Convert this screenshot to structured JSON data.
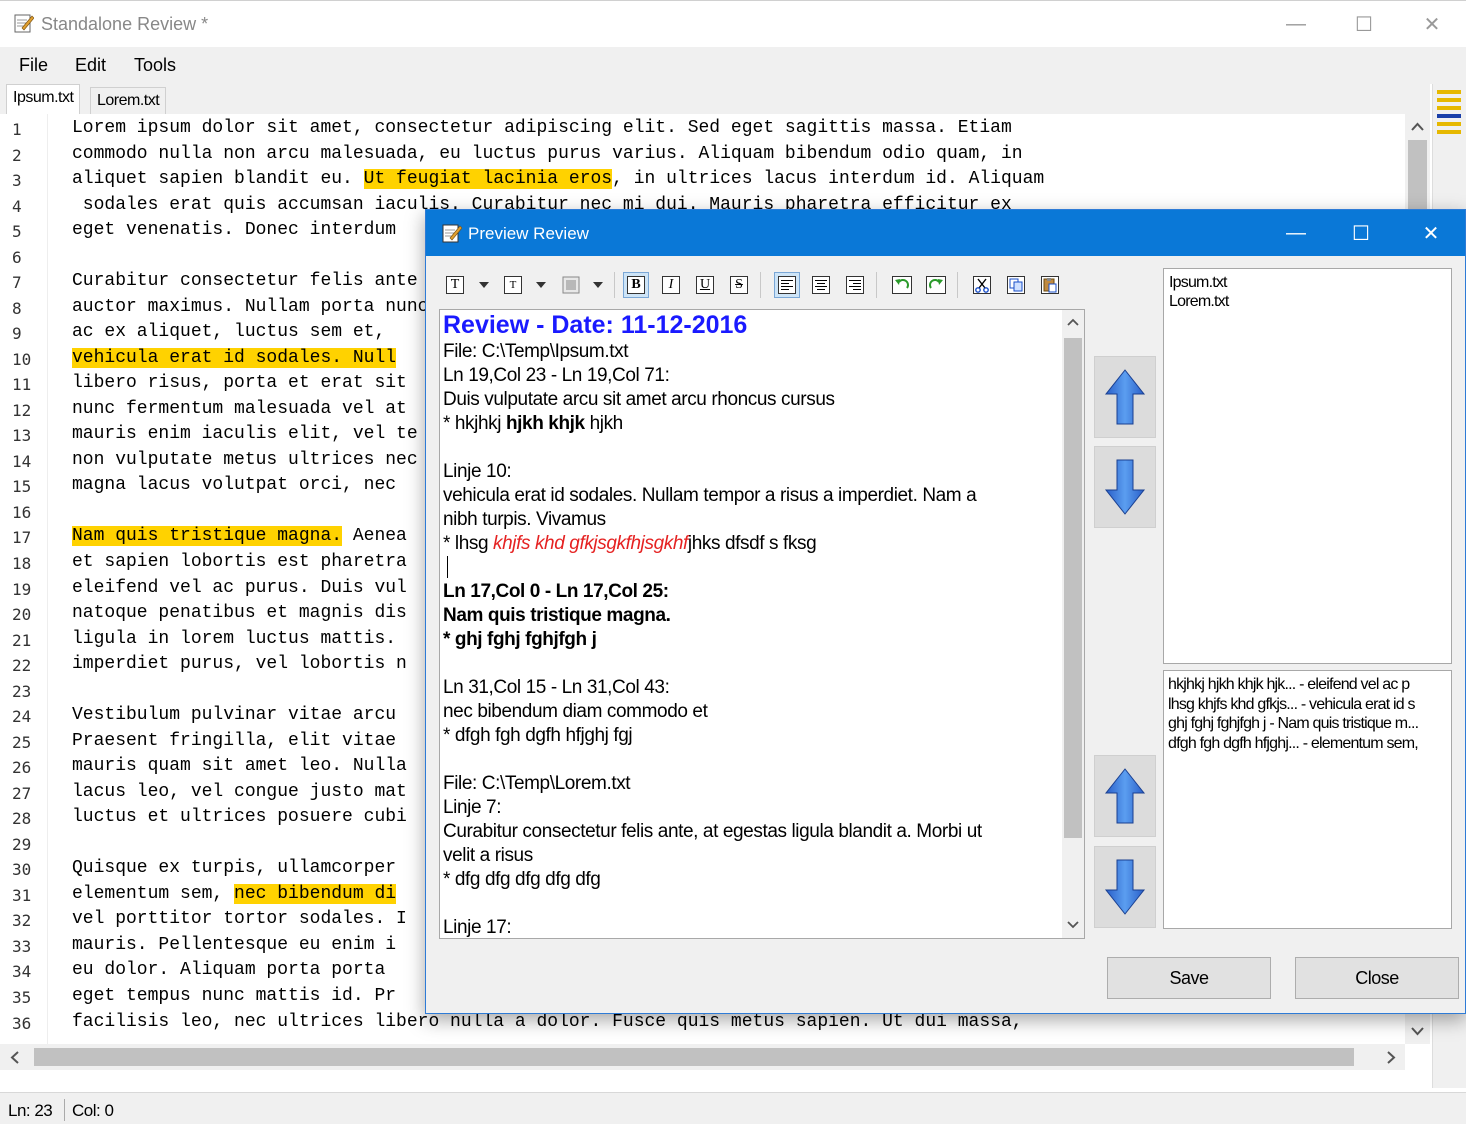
{
  "main": {
    "title": "Standalone Review *",
    "controls": {
      "minimize": "—",
      "maximize": "☐",
      "close": "✕"
    },
    "menu": [
      "File",
      "Edit",
      "Tools"
    ],
    "tabs": [
      "Ipsum.txt",
      "Lorem.txt"
    ],
    "line_numbers": [
      "1",
      "2",
      "3",
      "4",
      "5",
      "6",
      "7",
      "8",
      "9",
      "10",
      "11",
      "12",
      "13",
      "14",
      "15",
      "16",
      "17",
      "18",
      "19",
      "20",
      "21",
      "22",
      "23",
      "24",
      "25",
      "26",
      "27",
      "28",
      "29",
      "30",
      "31",
      "32",
      "33",
      "34",
      "35",
      "36"
    ],
    "code_lines": [
      {
        "pre": "Lorem ipsum dolor sit amet, consectetur adipiscing elit. Sed eget sagittis massa. Etiam"
      },
      {
        "pre": "commodo nulla non arcu malesuada, eu luctus purus varius. Aliquam bibendum odio quam, in"
      },
      {
        "pre": "aliquet sapien blandit eu. ",
        "hl": "Ut feugiat lacinia eros",
        "post": ", in ultrices lacus interdum id. Aliquam"
      },
      {
        "pre": " sodales erat quis accumsan iaculis. Curabitur nec mi dui. Mauris pharetra efficitur ex"
      },
      {
        "pre": "eget venenatis. Donec interdum"
      },
      {
        "pre": ""
      },
      {
        "pre": "Curabitur consectetur felis ante"
      },
      {
        "pre": "auctor maximus. Nullam porta nunc"
      },
      {
        "pre": "ac ex aliquet, luctus sem et, "
      },
      {
        "hl": "vehicula erat id sodales. Null"
      },
      {
        "pre": "libero risus, porta et erat sit"
      },
      {
        "pre": "nunc fermentum malesuada vel at"
      },
      {
        "pre": "mauris enim iaculis elit, vel te"
      },
      {
        "pre": "non vulputate metus ultrices nec"
      },
      {
        "pre": "magna lacus volutpat orci, nec"
      },
      {
        "pre": ""
      },
      {
        "hl": "Nam quis tristique magna.",
        "post": " Aenea"
      },
      {
        "pre": "et sapien lobortis est pharetra"
      },
      {
        "pre": "eleifend vel ac purus. Duis vul"
      },
      {
        "pre": "natoque penatibus et magnis dis"
      },
      {
        "pre": "ligula in lorem luctus mattis. "
      },
      {
        "pre": "imperdiet purus, vel lobortis n"
      },
      {
        "pre": ""
      },
      {
        "pre": "Vestibulum pulvinar vitae arcu "
      },
      {
        "pre": "Praesent fringilla, elit vitae "
      },
      {
        "pre": "mauris quam sit amet leo. Nulla"
      },
      {
        "pre": "lacus leo, vel congue justo mat"
      },
      {
        "pre": "luctus et ultrices posuere cubi"
      },
      {
        "pre": ""
      },
      {
        "pre": "Quisque ex turpis, ullamcorper "
      },
      {
        "pre": "elementum sem, ",
        "hl": "nec bibendum di"
      },
      {
        "pre": "vel porttitor tortor sodales. I"
      },
      {
        "pre": "mauris. Pellentesque eu enim i"
      },
      {
        "pre": "eu dolor. Aliquam porta porta "
      },
      {
        "pre": "eget tempus nunc mattis id. Pr"
      },
      {
        "pre": "facilisis leo, nec ultrices libero nulla a dolor. Fusce quis metus sapien. Ut dui massa,"
      }
    ],
    "status": {
      "line": "Ln: 23",
      "col": "Col: 0"
    }
  },
  "dialog": {
    "title": "Preview Review",
    "controls": {
      "minimize": "—",
      "maximize": "☐",
      "close": "✕"
    },
    "toolbar": {
      "font_glyph": "T",
      "size_glyph": "T",
      "bold": "B",
      "italic": "I",
      "underline": "U",
      "strike": "S"
    },
    "review": {
      "title": "Review - Date: 11-12-2016",
      "lines": [
        {
          "text": "File: C:\\Temp\\Ipsum.txt"
        },
        {
          "text": "Ln 19,Col 23 - Ln 19,Col 71:"
        },
        {
          "text": "Duis vulputate arcu sit amet arcu rhoncus cursus"
        },
        {
          "text": "* hkjhkj ",
          "bold": "hjkh khjk",
          "after": " hjkh"
        },
        {
          "text": ""
        },
        {
          "text": "Linje 10:"
        },
        {
          "text": "vehicula erat id sodales. Nullam tempor a risus a imperdiet. Nam a"
        },
        {
          "text": "nibh turpis. Vivamus"
        },
        {
          "text": "* lhsg ",
          "red": "khjfs khd gfkjsgkfhjsgkhf",
          "after": "jhks dfsdf s fksg"
        },
        {
          "text": ""
        },
        {
          "bold": "Ln 17,Col 0 - Ln 17,Col 25:"
        },
        {
          "bold": "Nam quis tristique magna."
        },
        {
          "bold": "*  ghj fghj fghjfgh j"
        },
        {
          "text": ""
        },
        {
          "text": "Ln 31,Col 15 - Ln 31,Col 43:"
        },
        {
          "text": "nec bibendum diam commodo et"
        },
        {
          "text": "* dfgh fgh dgfh hfjghj fgj"
        },
        {
          "text": ""
        },
        {
          "text": "File: C:\\Temp\\Lorem.txt"
        },
        {
          "text": "Linje 7:"
        },
        {
          "text": "Curabitur consectetur felis ante, at egestas ligula blandit a. Morbi ut"
        },
        {
          "text": "velit a risus"
        },
        {
          "text": "* dfg dfg dfg dfg dfg"
        },
        {
          "text": ""
        },
        {
          "text": "Linje 17:"
        }
      ]
    },
    "files": [
      "Ipsum.txt",
      "Lorem.txt"
    ],
    "comments": [
      "hkjhkj hjkh khjk hjk... - eleifend vel ac p",
      "lhsg khjfs khd gfkjs... - vehicula erat id s",
      "ghj fghj fghjfgh j - Nam quis tristique m...",
      "dfgh fgh dgfh hfjghj... - elementum sem,"
    ],
    "save_label": "Save",
    "close_label": "Close"
  }
}
